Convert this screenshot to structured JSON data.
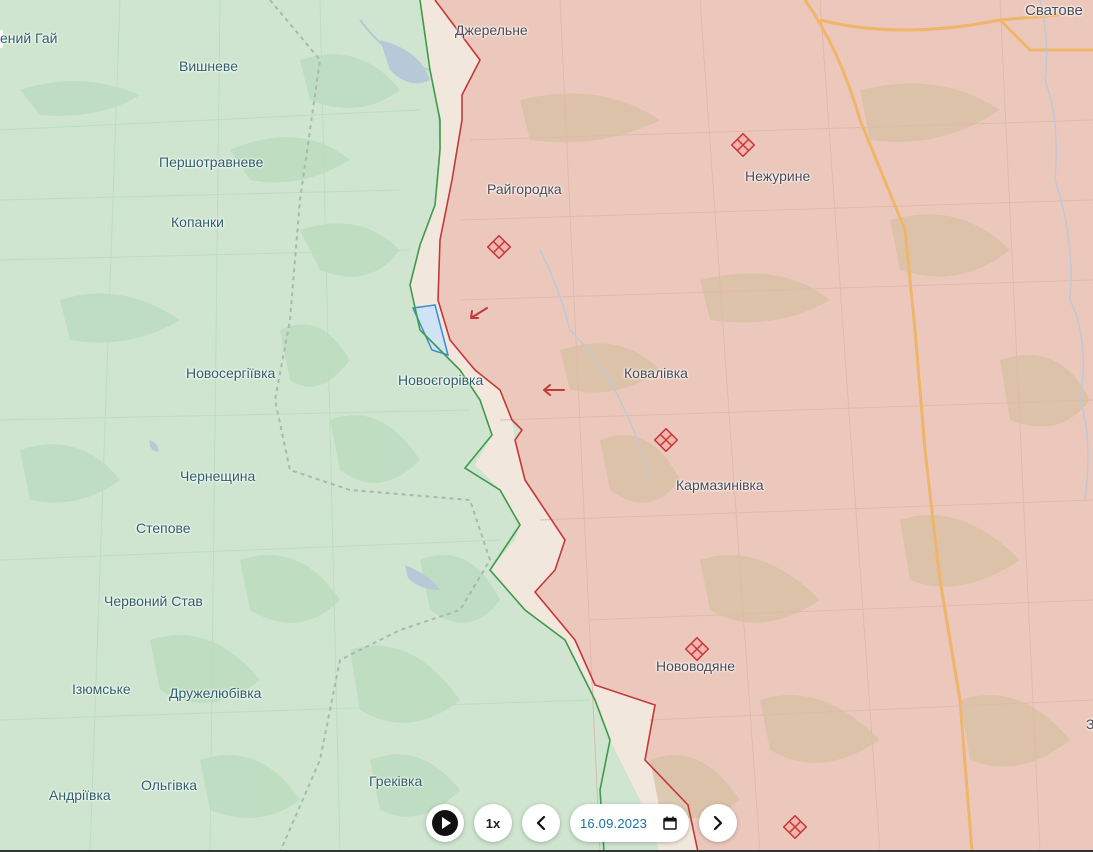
{
  "map": {
    "colors": {
      "ukraine_controlled": "#cfe5d0",
      "russian_occupied": "#ecc8bc",
      "contested": "#f2e7dc",
      "liberated": "#cfe3f4",
      "front_line_red": "#c4383a",
      "front_line_green": "#3f9a4c",
      "road": "#efb66a",
      "water": "#b7c9d6"
    },
    "settlements_ua": [
      {
        "name": "ений Гай"
      },
      {
        "name": "Вишневе"
      },
      {
        "name": "Першотравневе"
      },
      {
        "name": "Копанки"
      },
      {
        "name": "Новосергіївка"
      },
      {
        "name": "Новоєгорівка"
      },
      {
        "name": "Чернещина"
      },
      {
        "name": "Степове"
      },
      {
        "name": "Червоний Став"
      },
      {
        "name": "Ізюмське"
      },
      {
        "name": "Дружелюбівка"
      },
      {
        "name": "Ольгівка"
      },
      {
        "name": "Андріївка"
      },
      {
        "name": "Греківка"
      }
    ],
    "settlements_occupied": [
      {
        "name": "Джерельне"
      },
      {
        "name": "Райгородка"
      },
      {
        "name": "Нежурине"
      },
      {
        "name": "Ковалівка"
      },
      {
        "name": "Кармазинівка"
      },
      {
        "name": "Нововодяне"
      },
      {
        "name": "Сватове"
      },
      {
        "name": "З"
      }
    ],
    "event_markers": [
      {
        "type": "attack-icon"
      },
      {
        "type": "attack-icon"
      },
      {
        "type": "attack-icon"
      },
      {
        "type": "attack-icon"
      },
      {
        "type": "attack-icon"
      }
    ],
    "direction_arrows": [
      {
        "type": "arrow-left-icon"
      },
      {
        "type": "arrow-left-icon"
      }
    ]
  },
  "controls": {
    "play_icon": "play-icon",
    "speed_label": "1x",
    "prev_icon": "chevron-left-icon",
    "date_value": "16.09.2023",
    "calendar_icon": "calendar-icon",
    "next_icon": "chevron-right-icon"
  }
}
